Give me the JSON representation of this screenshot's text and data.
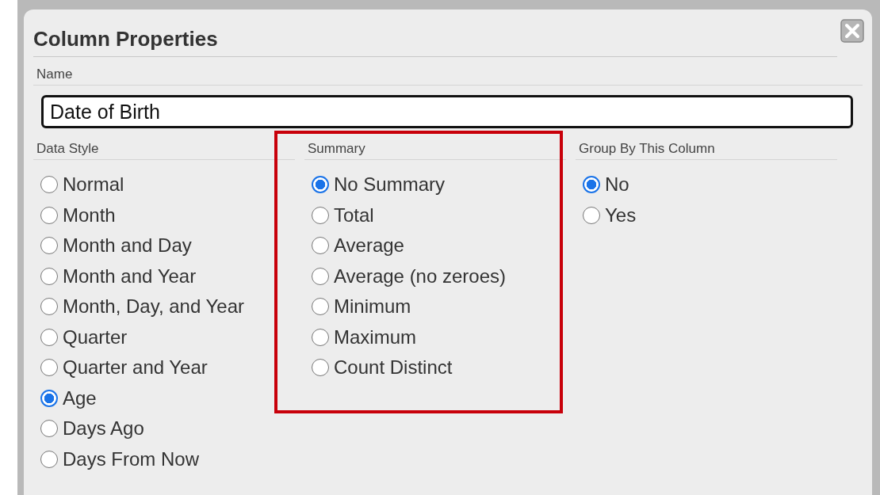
{
  "dialog": {
    "title": "Column Properties",
    "name_label": "Name",
    "name_value": "Date of Birth",
    "groups": [
      {
        "heading": "Data Style",
        "highlighted": false,
        "options": [
          {
            "label": "Normal",
            "selected": false
          },
          {
            "label": "Month",
            "selected": false
          },
          {
            "label": "Month and Day",
            "selected": false
          },
          {
            "label": "Month and Year",
            "selected": false
          },
          {
            "label": "Month, Day, and Year",
            "selected": false
          },
          {
            "label": "Quarter",
            "selected": false
          },
          {
            "label": "Quarter and Year",
            "selected": false
          },
          {
            "label": "Age",
            "selected": true
          },
          {
            "label": "Days Ago",
            "selected": false
          },
          {
            "label": "Days From Now",
            "selected": false
          }
        ]
      },
      {
        "heading": "Summary",
        "highlighted": true,
        "options": [
          {
            "label": "No Summary",
            "selected": true
          },
          {
            "label": "Total",
            "selected": false
          },
          {
            "label": "Average",
            "selected": false
          },
          {
            "label": "Average (no zeroes)",
            "selected": false
          },
          {
            "label": "Minimum",
            "selected": false
          },
          {
            "label": "Maximum",
            "selected": false
          },
          {
            "label": "Count Distinct",
            "selected": false
          }
        ]
      },
      {
        "heading": "Group By This Column",
        "highlighted": false,
        "options": [
          {
            "label": "No",
            "selected": true
          },
          {
            "label": "Yes",
            "selected": false
          }
        ]
      }
    ]
  }
}
